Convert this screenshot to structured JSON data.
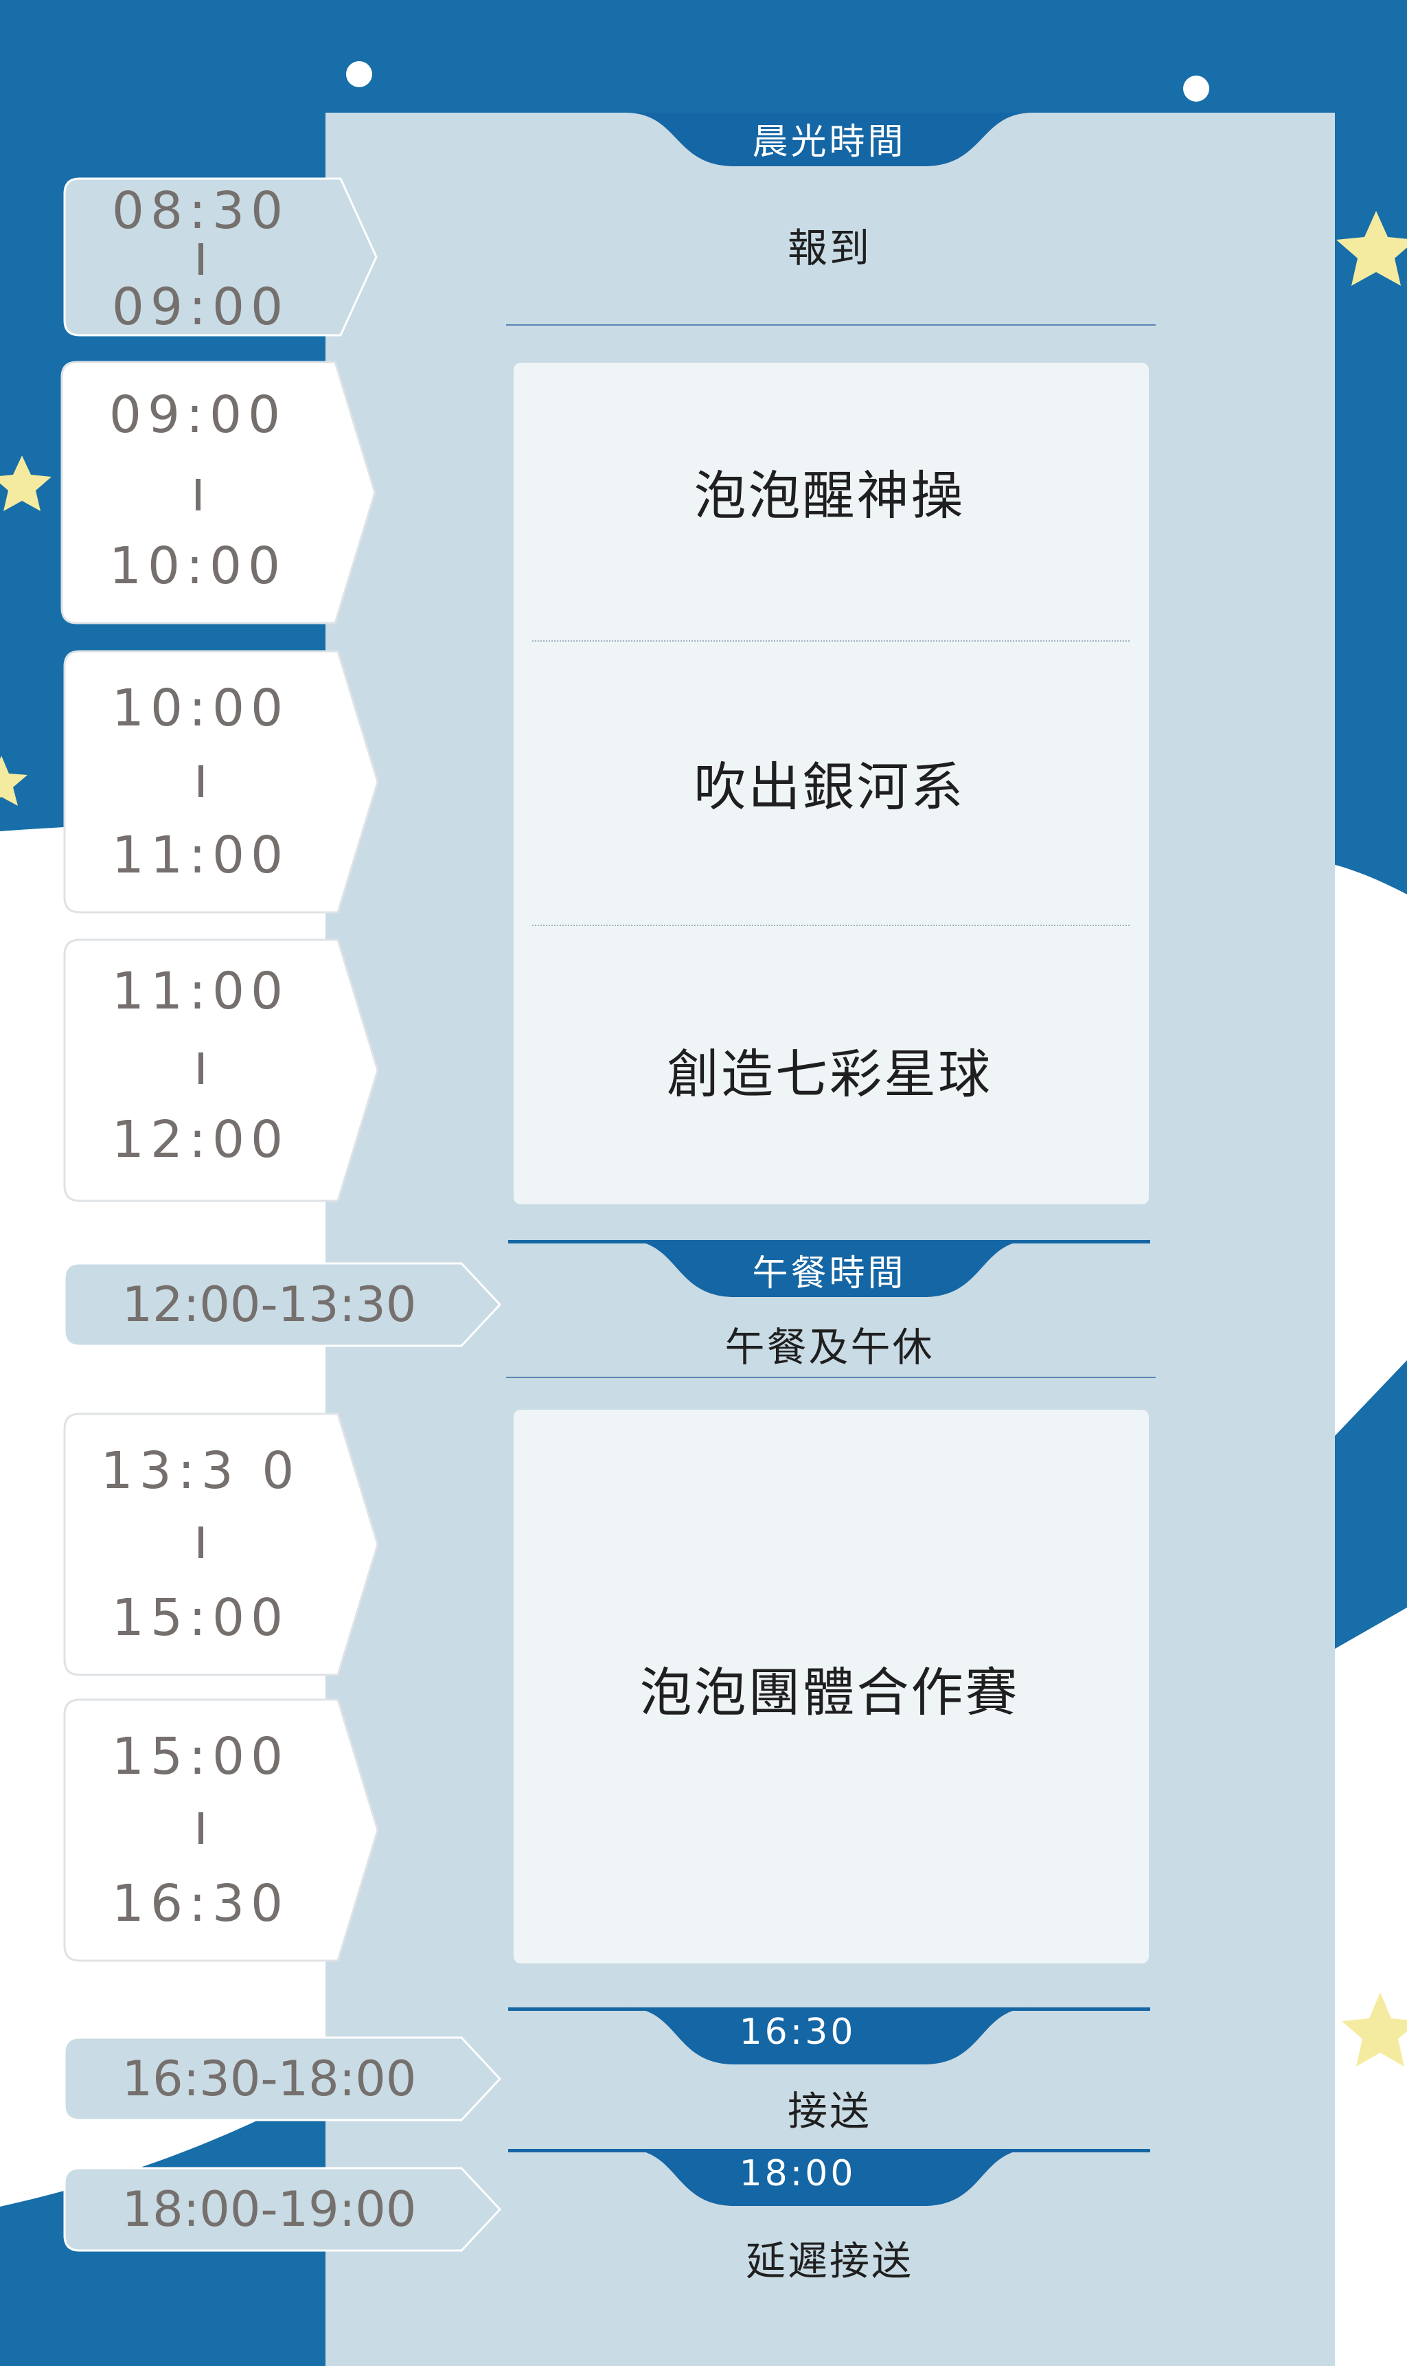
{
  "header": {
    "label": "晨光時間"
  },
  "schedule": [
    {
      "start": "08:30",
      "end": "09:00",
      "activity": "報到"
    },
    {
      "start": "09:00",
      "end": "10:00",
      "activity": "泡泡醒神操"
    },
    {
      "start": "10:00",
      "end": "11:00",
      "activity": "吹出銀河系"
    },
    {
      "start": "11:00",
      "end": "12:00",
      "activity": "創造七彩星球"
    },
    {
      "time": "12:00-13:30",
      "section": "午餐時間",
      "activity": "午餐及午休"
    },
    {
      "start": "13:3 0",
      "end": "15:00"
    },
    {
      "start": "15:00",
      "end": "16:30",
      "activity": "泡泡團體合作賽"
    },
    {
      "time": "16:30-18:00",
      "section": "16:30",
      "activity": "接送"
    },
    {
      "time": "18:00-19:00",
      "section": "18:00",
      "activity": "延遲接送"
    }
  ],
  "colors": {
    "background_blue": "#176ea8",
    "panel": "#c9dbe4",
    "card": "#eff4f7",
    "tab": "#1566a4",
    "star": "#f5eba0",
    "time_text": "#75706d"
  }
}
